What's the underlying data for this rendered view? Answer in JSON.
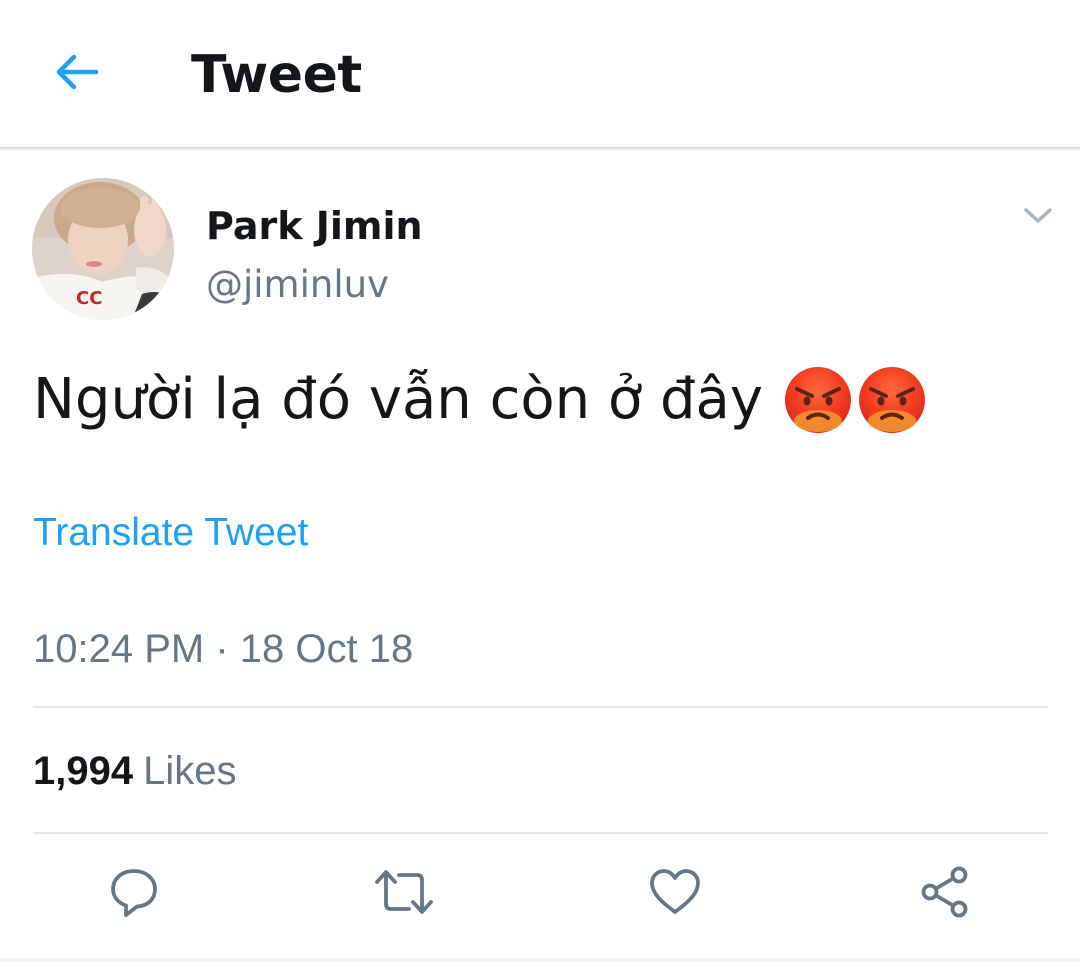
{
  "header": {
    "title": "Tweet",
    "back_icon": "back-arrow-icon"
  },
  "author": {
    "display_name": "Park Jimin",
    "handle": "@jiminluv",
    "avatar": "profile-photo",
    "menu_icon": "chevron-down-icon"
  },
  "tweet": {
    "text": "Người lạ đó vẫn còn ở đây",
    "emojis": [
      "angry-face",
      "angry-face"
    ],
    "translate_label": "Translate Tweet",
    "timestamp": "10:24 PM · 18 Oct 18"
  },
  "stats": {
    "likes_count": "1,994",
    "likes_label": "Likes"
  },
  "actions": [
    {
      "name": "reply",
      "icon": "reply-icon"
    },
    {
      "name": "retweet",
      "icon": "retweet-icon"
    },
    {
      "name": "like",
      "icon": "heart-icon"
    },
    {
      "name": "share",
      "icon": "share-icon"
    }
  ],
  "colors": {
    "link": "#1da1f2",
    "primary_text": "#14171a",
    "secondary_text": "#657786",
    "divider": "#e1e8ed"
  }
}
